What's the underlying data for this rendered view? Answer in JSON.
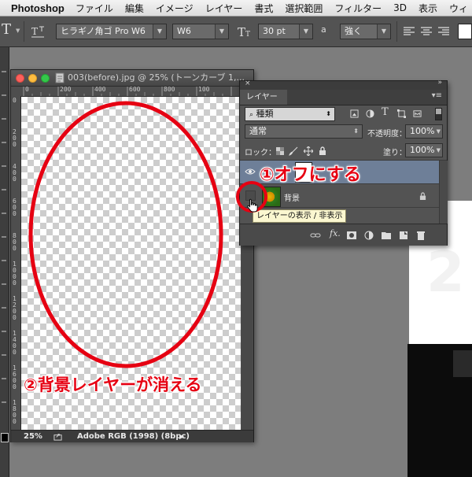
{
  "menubar": {
    "app_name": "Photoshop",
    "items": [
      "ファイル",
      "編集",
      "イメージ",
      "レイヤー",
      "書式",
      "選択範囲",
      "フィルター",
      "3D",
      "表示",
      "ウィ"
    ]
  },
  "options_bar": {
    "tool_icon": "T",
    "font_family": "ヒラギノ角ゴ Pro W6",
    "font_style": "W6",
    "font_size": "30 pt",
    "aa_label": "a",
    "antialias": "強く"
  },
  "document": {
    "title": "003(before).jpg @ 25% (トーンカーブ 1,...",
    "hruler_labels": [
      "0",
      "200",
      "400",
      "600",
      "800",
      "100"
    ],
    "vruler_labels": [
      "0",
      "2 0 0",
      "4 0 0",
      "6 0 0",
      "8 0 0",
      "1 0 0 0",
      "1 2 0 0",
      "1 4 0 0",
      "1 6 0 0",
      "1 8 0 0"
    ],
    "zoom": "25%",
    "color_profile": "Adobe RGB (1998) (8bpc)"
  },
  "layers_panel": {
    "tab_label": "レイヤー",
    "filter_label": "種類",
    "blend_mode": "通常",
    "opacity_label": "不透明度：",
    "opacity_value": "100%",
    "lock_label": "ロック：",
    "fill_label": "塗り：",
    "fill_value": "100%",
    "layers": [
      {
        "name": "",
        "visible": true,
        "selected": true
      },
      {
        "name": "背景",
        "visible": false,
        "selected": false
      }
    ],
    "tooltip": "レイヤーの表示 / 非表示",
    "footer_icons": [
      "link-icon",
      "fx-icon",
      "mask-icon",
      "adjustment-icon",
      "folder-icon",
      "new-layer-icon",
      "trash-icon"
    ],
    "footer_fx": "fx."
  },
  "annotations": {
    "step1": "①オフにする",
    "step2": "②背景レイヤーが消える",
    "color": "#e60012"
  }
}
